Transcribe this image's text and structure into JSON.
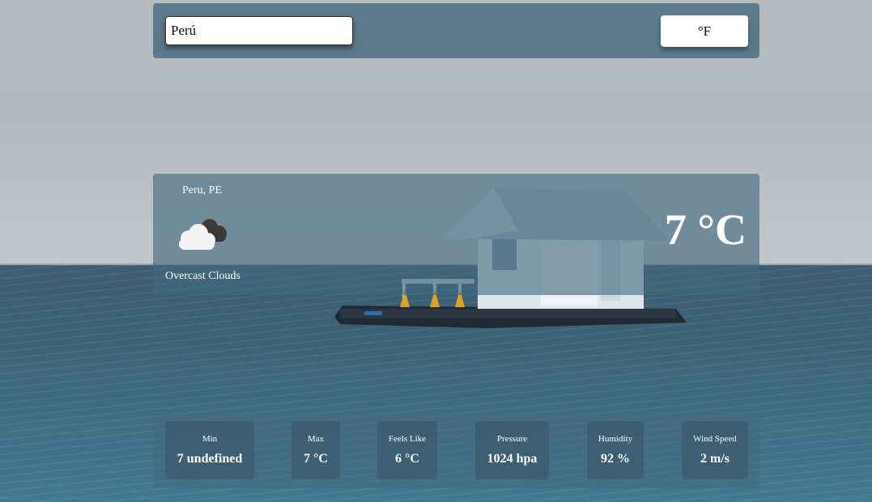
{
  "search": {
    "value": "Perú"
  },
  "unit_toggle": {
    "label": "°F"
  },
  "current": {
    "location": "Peru, PE",
    "icon": "overcast-clouds-icon",
    "condition": "Overcast Clouds",
    "temperature": "7 °C"
  },
  "stats": [
    {
      "label": "Min",
      "value": "7 undefined"
    },
    {
      "label": "Max",
      "value": "7 °C"
    },
    {
      "label": "Feels Like",
      "value": "6 °C"
    },
    {
      "label": "Pressure",
      "value": "1024 hpa"
    },
    {
      "label": "Humidity",
      "value": "92 %"
    },
    {
      "label": "Wind Speed",
      "value": "2 m/s"
    }
  ]
}
